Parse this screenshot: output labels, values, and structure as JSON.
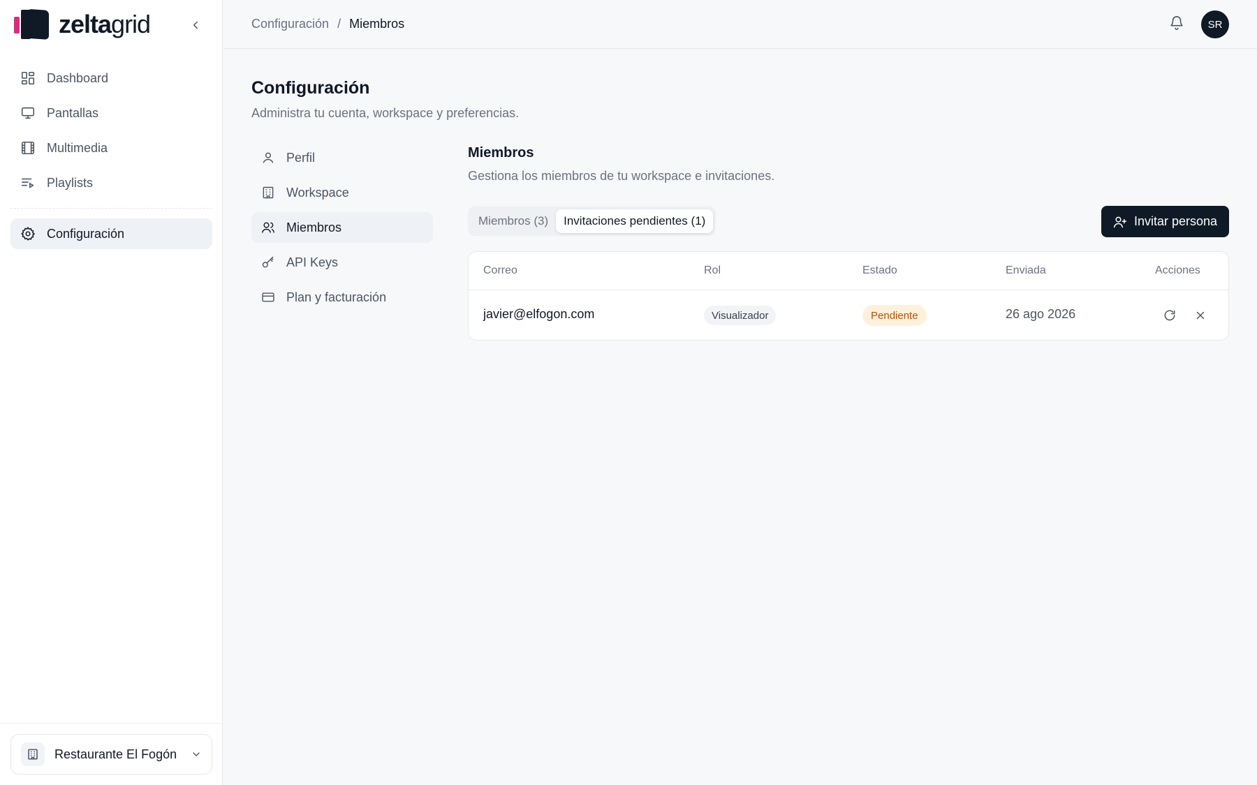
{
  "brand": {
    "name_bold": "zelta",
    "name_light": "grid"
  },
  "sidebar": {
    "items": [
      {
        "label": "Dashboard",
        "icon": "dashboard-icon"
      },
      {
        "label": "Pantallas",
        "icon": "monitor-icon"
      },
      {
        "label": "Multimedia",
        "icon": "film-icon"
      },
      {
        "label": "Playlists",
        "icon": "playlist-icon"
      }
    ],
    "settings": {
      "label": "Configuración",
      "icon": "gear-icon"
    },
    "workspace": {
      "name": "Restaurante El Fogón"
    }
  },
  "topbar": {
    "breadcrumb": {
      "parent": "Configuración",
      "separator": "/",
      "current": "Miembros"
    },
    "avatar_initials": "SR"
  },
  "page": {
    "title": "Configuración",
    "subtitle": "Administra tu cuenta, workspace y preferencias."
  },
  "subnav": {
    "items": [
      {
        "label": "Perfil"
      },
      {
        "label": "Workspace"
      },
      {
        "label": "Miembros"
      },
      {
        "label": "API Keys"
      },
      {
        "label": "Plan y facturación"
      }
    ]
  },
  "members": {
    "title": "Miembros",
    "subtitle": "Gestiona los miembros de tu workspace e invitaciones.",
    "tabs": [
      {
        "label": "Miembros (3)"
      },
      {
        "label": "Invitaciones pendientes (1)"
      }
    ],
    "invite_label": "Invitar persona",
    "table": {
      "headers": [
        "Correo",
        "Rol",
        "Estado",
        "Enviada",
        "Acciones"
      ],
      "rows": [
        {
          "email": "javier@elfogon.com",
          "role": "Visualizador",
          "status": "Pendiente",
          "sent": "26 ago 2026"
        }
      ]
    }
  },
  "colors": {
    "primary": "#0f1a26",
    "accent": "#d62e7f",
    "pending_bg": "#fdf1dc",
    "pending_text": "#b45309"
  }
}
